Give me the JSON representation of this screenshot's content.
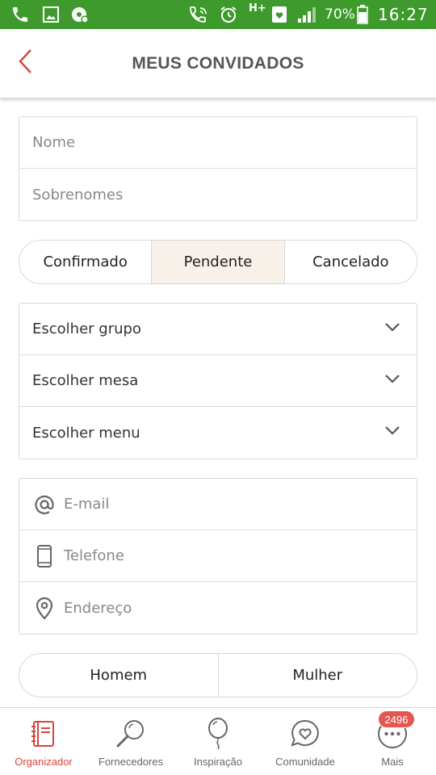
{
  "status_bar": {
    "battery": "70%",
    "time": "16:27",
    "network": "H+"
  },
  "header": {
    "title": "MEUS CONVIDADOS"
  },
  "name_fields": {
    "first_name_placeholder": "Nome",
    "last_name_placeholder": "Sobrenomes"
  },
  "status_segment": {
    "options": [
      "Confirmado",
      "Pendente",
      "Cancelado"
    ],
    "selected": "Pendente"
  },
  "selects": {
    "group": "Escolher grupo",
    "table": "Escolher mesa",
    "menu": "Escolher menu"
  },
  "contact_fields": {
    "email_placeholder": "E-mail",
    "phone_placeholder": "Telefone",
    "address_placeholder": "Endereço"
  },
  "gender_segment": {
    "options": [
      "Homem",
      "Mulher"
    ]
  },
  "tabbar": {
    "tabs": [
      {
        "label": "Organizador",
        "icon": "notebook-icon",
        "active": true
      },
      {
        "label": "Fornecedores",
        "icon": "magnifier-icon",
        "active": false
      },
      {
        "label": "Inspiração",
        "icon": "balloon-icon",
        "active": false
      },
      {
        "label": "Comunidade",
        "icon": "chat-heart-icon",
        "active": false
      },
      {
        "label": "Mais",
        "icon": "more-dots-icon",
        "active": false
      }
    ],
    "more_badge": "2496"
  },
  "colors": {
    "status_bar": "#3f9a2d",
    "accent": "#d6463d",
    "selected_segment": "#f7f1e9",
    "badge": "#e35753"
  }
}
